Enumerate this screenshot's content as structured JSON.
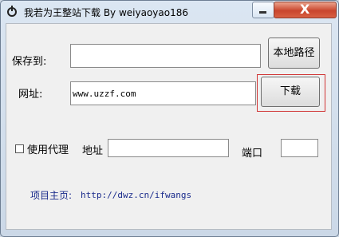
{
  "window": {
    "title": "我若为王整站下载  By weiyaoyao186",
    "close_symbol": "X"
  },
  "form": {
    "save_label": "保存到:",
    "save_value": "",
    "local_path_button": "本地路径",
    "url_label": "网址:",
    "url_value": "www.uzzf.com",
    "download_button": "下载",
    "proxy_checkbox_label": "使用代理",
    "proxy_checked": false,
    "address_label": "地址",
    "address_value": "",
    "port_label": "端口",
    "port_value": ""
  },
  "footer": {
    "homepage_label": "项目主页:",
    "homepage_url": "http://dwz.cn/ifwangs"
  },
  "colors": {
    "highlight": "#d13535",
    "link": "#1a2b8c",
    "close_button": "#c9452d"
  }
}
